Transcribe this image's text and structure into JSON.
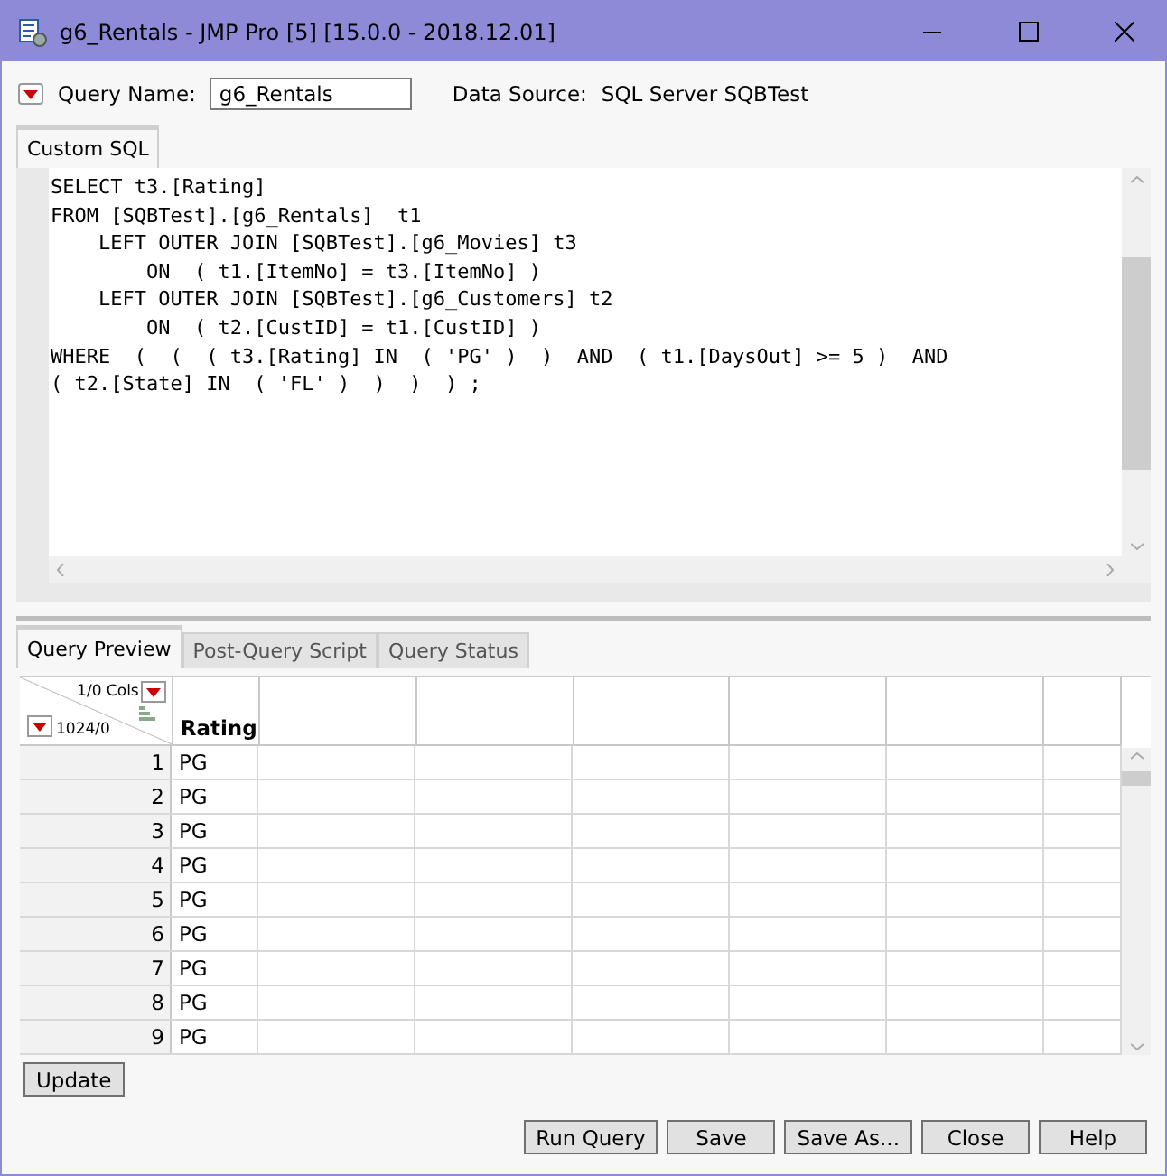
{
  "window": {
    "title": "g6_Rentals - JMP Pro [5] [15.0.0 - 2018.12.01]"
  },
  "query_name": {
    "label": "Query Name:",
    "value": "g6_Rentals"
  },
  "data_source": {
    "label": "Data Source:",
    "value": "SQL Server SQBTest"
  },
  "sql_tab": {
    "label": "Custom SQL"
  },
  "sql_lines": [
    "SELECT t3.[Rating]",
    "FROM [SQBTest].[g6_Rentals]  t1",
    "    LEFT OUTER JOIN [SQBTest].[g6_Movies] t3",
    "        ON  ( t1.[ItemNo] = t3.[ItemNo] )",
    "    LEFT OUTER JOIN [SQBTest].[g6_Customers] t2",
    "        ON  ( t2.[CustID] = t1.[CustID] )",
    "WHERE  (  (  ( t3.[Rating] IN  ( 'PG' )  )  AND  ( t1.[DaysOut] >= 5 )  AND",
    "( t2.[State] IN  ( 'FL' )  )  )  ) ;"
  ],
  "result_tabs": [
    {
      "label": "Query Preview",
      "selected": true
    },
    {
      "label": "Post-Query Script",
      "selected": false
    },
    {
      "label": "Query Status",
      "selected": false
    }
  ],
  "grid": {
    "cols_count": "1/0 Cols",
    "rows_count": "1024/0",
    "columns": [
      "Rating"
    ],
    "rows": [
      {
        "num": "1",
        "values": [
          "PG"
        ]
      },
      {
        "num": "2",
        "values": [
          "PG"
        ]
      },
      {
        "num": "3",
        "values": [
          "PG"
        ]
      },
      {
        "num": "4",
        "values": [
          "PG"
        ]
      },
      {
        "num": "5",
        "values": [
          "PG"
        ]
      },
      {
        "num": "6",
        "values": [
          "PG"
        ]
      },
      {
        "num": "7",
        "values": [
          "PG"
        ]
      },
      {
        "num": "8",
        "values": [
          "PG"
        ]
      },
      {
        "num": "9",
        "values": [
          "PG"
        ]
      }
    ]
  },
  "update_button": "Update",
  "buttons": [
    "Run Query",
    "Save",
    "Save As...",
    "Close",
    "Help"
  ]
}
